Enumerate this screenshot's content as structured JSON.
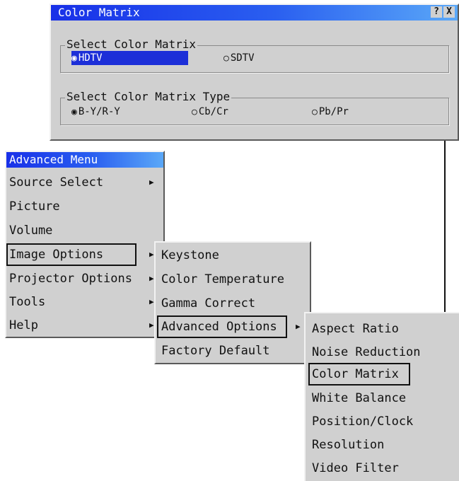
{
  "color_matrix_dialog": {
    "title": "Color Matrix",
    "help_button": "?",
    "close_button": "X",
    "group1": {
      "legend": "Select Color Matrix",
      "options": [
        "HDTV",
        "SDTV"
      ],
      "selected": "HDTV"
    },
    "group2": {
      "legend": "Select Color Matrix Type",
      "options": [
        "B-Y/R-Y",
        "Cb/Cr",
        "Pb/Pr"
      ],
      "selected": "B-Y/R-Y"
    }
  },
  "advanced_menu": {
    "title": "Advanced Menu",
    "items": [
      "Source Select",
      "Picture",
      "Volume",
      "Image Options",
      "Projector Options",
      "Tools",
      "Help"
    ]
  },
  "image_options_menu": {
    "items": [
      "Keystone",
      "Color Temperature",
      "Gamma Correct",
      "Advanced Options",
      "Factory Default"
    ]
  },
  "advanced_options_menu": {
    "items": [
      "Aspect Ratio",
      "Noise Reduction",
      "Color Matrix",
      "White Balance",
      "Position/Clock",
      "Resolution",
      "Video Filter"
    ]
  },
  "icons": {
    "submenu_arrow": "right-triangle",
    "radio_selected": "filled-radio",
    "radio_unselected": "empty-radio"
  },
  "colors": {
    "title_gradient_start": "#1830e8",
    "title_gradient_end": "#5aa8f8",
    "panel_bg": "#d0d0d0",
    "selected_bg": "#1c2fd8"
  }
}
